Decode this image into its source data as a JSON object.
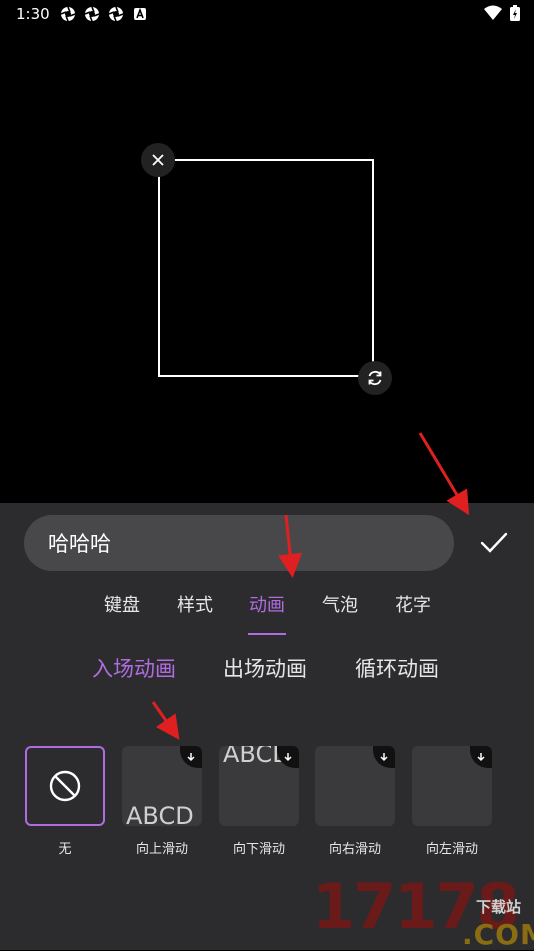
{
  "status": {
    "time": "1:30",
    "icons": [
      "aperture-icon",
      "aperture-icon",
      "aperture-icon",
      "font-a-icon"
    ],
    "right_icons": [
      "wifi-icon",
      "battery-icon"
    ]
  },
  "preview": {
    "handles": [
      "close-icon",
      "rotate-icon"
    ]
  },
  "editor": {
    "input_value": "哈哈哈",
    "confirm_icon": "check-icon"
  },
  "tabs": [
    {
      "label": "键盘",
      "active": false
    },
    {
      "label": "样式",
      "active": false
    },
    {
      "label": "动画",
      "active": true
    },
    {
      "label": "气泡",
      "active": false
    },
    {
      "label": "花字",
      "active": false
    }
  ],
  "subtabs": [
    {
      "label": "入场动画",
      "active": true
    },
    {
      "label": "出场动画",
      "active": false
    },
    {
      "label": "循环动画",
      "active": false
    }
  ],
  "animations": [
    {
      "label": "无",
      "selected": true,
      "icon": "ban-icon",
      "sample": ""
    },
    {
      "label": "向上滑动",
      "selected": false,
      "icon": "download-icon",
      "sample": "ABCD"
    },
    {
      "label": "向下滑动",
      "selected": false,
      "icon": "download-icon",
      "sample": "ABCD"
    },
    {
      "label": "向右滑动",
      "selected": false,
      "icon": "download-icon",
      "sample": ""
    },
    {
      "label": "向左滑动",
      "selected": false,
      "icon": "download-icon",
      "sample": ""
    }
  ],
  "watermark": {
    "number": "17178",
    "sub": "下载站",
    "domain": ".COM"
  },
  "colors": {
    "accent": "#b06ce0",
    "panel": "#2c2c2e",
    "annotation": "#e02020"
  }
}
